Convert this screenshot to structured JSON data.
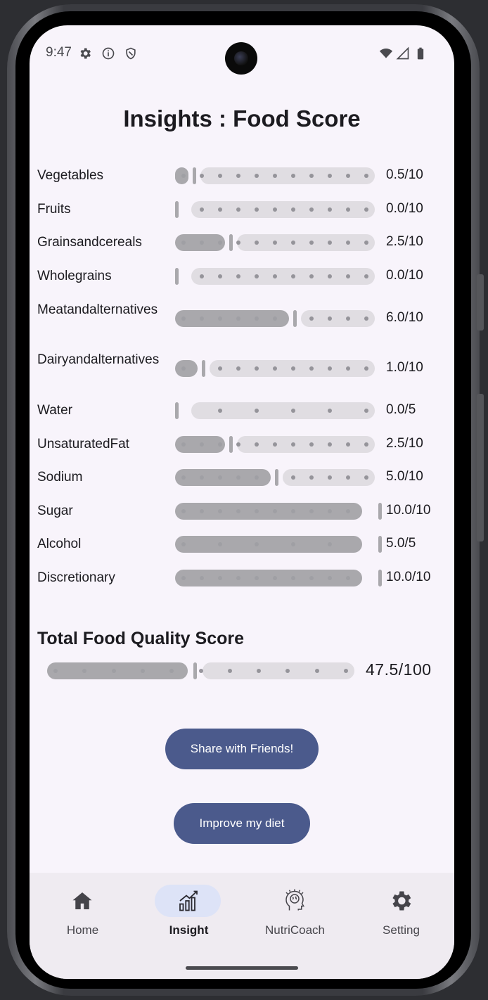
{
  "status_bar": {
    "time": "9:47",
    "left_icons": [
      "gear-icon",
      "info-icon",
      "shield-icon"
    ],
    "right_icons": [
      "wifi-icon",
      "signal-icon",
      "battery-icon"
    ]
  },
  "page": {
    "title": "Insights : Food Score"
  },
  "scores": [
    {
      "label": "Vegetables",
      "value_text": "0.5/10",
      "value": 0.5,
      "max": 10
    },
    {
      "label": "Fruits",
      "value_text": "0.0/10",
      "value": 0.0,
      "max": 10
    },
    {
      "label": "Grainsandcereals",
      "value_text": "2.5/10",
      "value": 2.5,
      "max": 10
    },
    {
      "label": "Wholegrains",
      "value_text": "0.0/10",
      "value": 0.0,
      "max": 10
    },
    {
      "label": "Meatandalternatives",
      "value_text": "6.0/10",
      "value": 6.0,
      "max": 10
    },
    {
      "label": "Dairyandalternatives",
      "value_text": "1.0/10",
      "value": 1.0,
      "max": 10
    },
    {
      "label": "Water",
      "value_text": "0.0/5",
      "value": 0.0,
      "max": 5
    },
    {
      "label": "UnsaturatedFat",
      "value_text": "2.5/10",
      "value": 2.5,
      "max": 10
    },
    {
      "label": "Sodium",
      "value_text": "5.0/10",
      "value": 5.0,
      "max": 10
    },
    {
      "label": "Sugar",
      "value_text": "10.0/10",
      "value": 10.0,
      "max": 10
    },
    {
      "label": "Alcohol",
      "value_text": "5.0/5",
      "value": 5.0,
      "max": 5
    },
    {
      "label": "Discretionary",
      "value_text": "10.0/10",
      "value": 10.0,
      "max": 10
    }
  ],
  "total": {
    "title": "Total Food Quality Score",
    "value_text": "47.5/100",
    "value": 47.5,
    "max": 100
  },
  "buttons": {
    "share": "Share with Friends!",
    "improve": "Improve my diet"
  },
  "bottom_nav": {
    "selected": "insight",
    "items": [
      {
        "id": "home",
        "label": "Home",
        "icon": "home-icon"
      },
      {
        "id": "insight",
        "label": "Insight",
        "icon": "chart-icon"
      },
      {
        "id": "nutricoach",
        "label": "NutriCoach",
        "icon": "brain-icon"
      },
      {
        "id": "setting",
        "label": "Setting",
        "icon": "gear-icon"
      }
    ]
  },
  "colors": {
    "primary": "#4b5a8c",
    "track_active": "#a9a8ac",
    "track_inactive": "#e0dde2",
    "nav_pill": "#dde3f7",
    "background": "#f8f4fb"
  }
}
